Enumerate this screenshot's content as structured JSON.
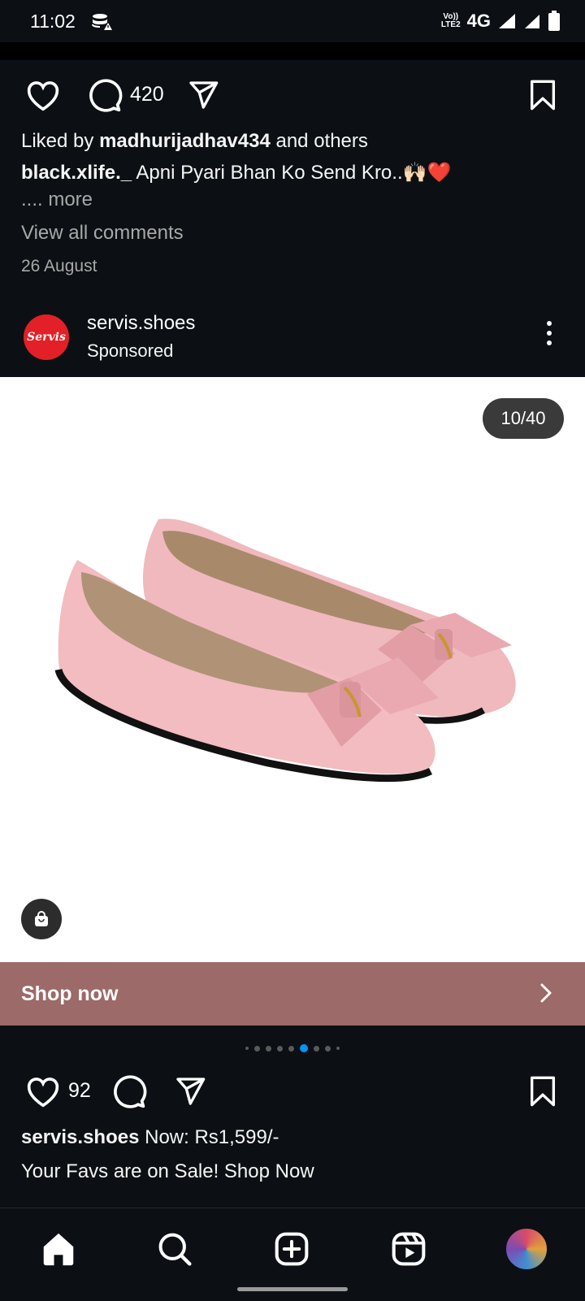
{
  "status_bar": {
    "time": "11:02",
    "network": "4G",
    "volte_top": "Vo))",
    "volte_bottom": "LTE2"
  },
  "post1": {
    "comment_count": "420",
    "liked_by_prefix": "Liked by ",
    "liked_by_user": "madhurijadhav434",
    "liked_by_suffix": " and others",
    "caption_user": "black.xlife._",
    "caption_text": " Apni Pyari Bhan Ko Send Kro..🙌🏻❤️",
    "more_label": ".... more",
    "view_comments": "View all comments",
    "date": "26 August"
  },
  "post2": {
    "username": "servis.shoes",
    "avatar_text": "Servis",
    "sponsored": "Sponsored",
    "carousel_counter": "10/40",
    "shop_now": "Shop now",
    "like_count": "92",
    "caption_user": "servis.shoes",
    "caption_text": " Now: Rs1,599/-",
    "caption_line2": "Your Favs are on Sale! Shop Now",
    "carousel_total_dots": 9,
    "carousel_active_dot": 5
  },
  "colors": {
    "background": "#0c1014",
    "shop_bar": "#9c6a68",
    "accent": "#0095f6",
    "shoe_pink": "#f0b9be"
  },
  "nav": {
    "items": [
      "home-icon",
      "search-icon",
      "create-icon",
      "reels-icon",
      "profile-avatar"
    ]
  }
}
